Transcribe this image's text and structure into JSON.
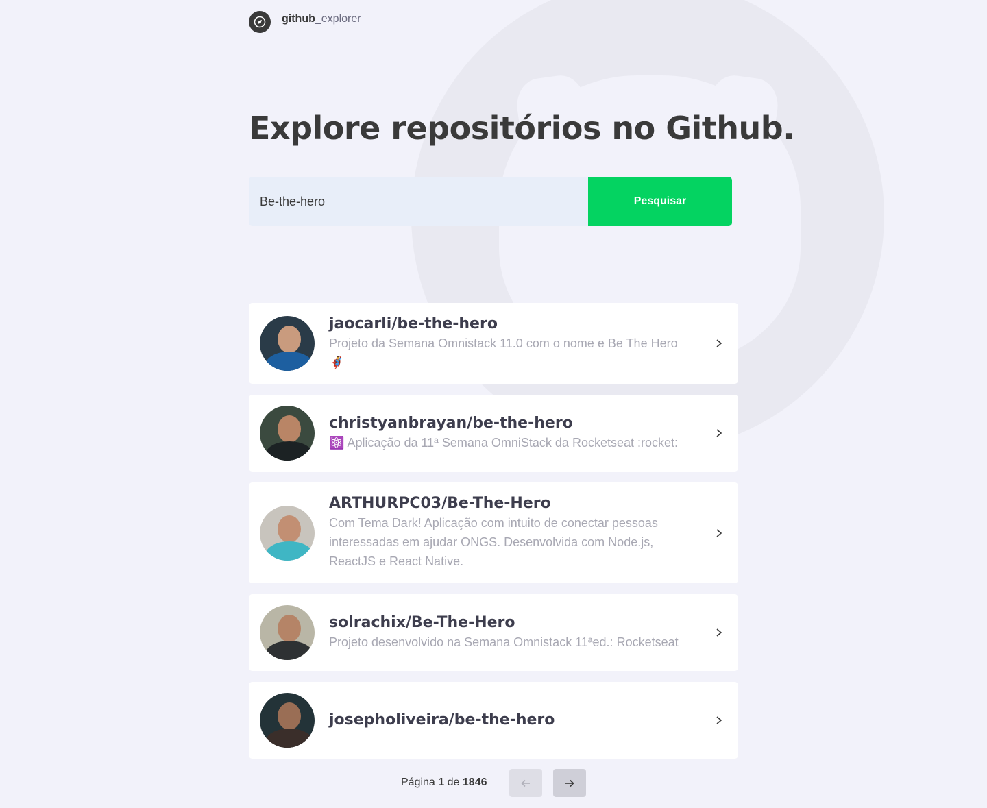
{
  "brand": {
    "name_bold": "github",
    "name_light": "_explorer"
  },
  "title": "Explore repositórios no Github.",
  "search": {
    "value": "Be-the-hero",
    "placeholder": "",
    "button_label": "Pesquisar"
  },
  "repositories": [
    {
      "name": "jaocarli/be-the-hero",
      "description": "Projeto da Semana Omnistack 11.0 com o nome e Be The Hero",
      "emoji": "🦸‍♂️"
    },
    {
      "name": "christyanbrayan/be-the-hero",
      "description": "Aplicação da 11ª Semana OmniStack da Rocketseat :rocket:",
      "emoji": "⚛️"
    },
    {
      "name": "ARTHURPC03/Be-The-Hero",
      "description": "Com Tema Dark! Aplicação com intuito de conectar pessoas interessadas em ajudar ONGS. Desenvolvida com Node.js, ReactJS e React Native."
    },
    {
      "name": "solrachix/Be-The-Hero",
      "description": "Projeto desenvolvido na Semana Omnistack 11ªed.: Rocketseat"
    },
    {
      "name": "josepholiveira/be-the-hero",
      "description": ""
    }
  ],
  "pagination": {
    "label_prefix": "Página",
    "current": "1",
    "label_mid": "de",
    "total": "1846"
  },
  "colors": {
    "accent": "#04d361",
    "background": "#f2f2fa",
    "text": "#3a3a3a",
    "muted": "#a8a8b3"
  }
}
